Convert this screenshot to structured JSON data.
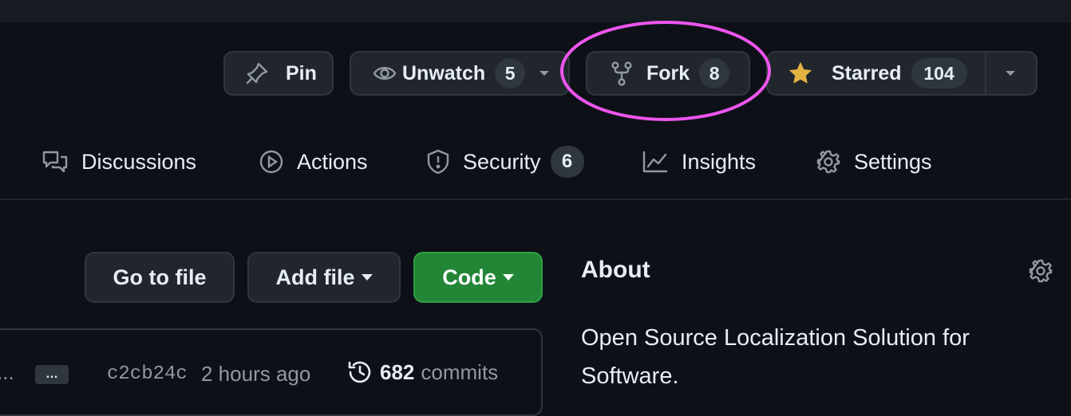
{
  "header": {
    "pin_label": "Pin",
    "unwatch_label": "Unwatch",
    "unwatch_count": "5",
    "fork_label": "Fork",
    "fork_count": "8",
    "starred_label": "Starred",
    "starred_count": "104"
  },
  "tabs": [
    {
      "label": "Discussions",
      "icon": "comment-discussion-icon"
    },
    {
      "label": "Actions",
      "icon": "play-icon"
    },
    {
      "label": "Security",
      "icon": "shield-icon",
      "counter": "6"
    },
    {
      "label": "Insights",
      "icon": "graph-icon"
    },
    {
      "label": "Settings",
      "icon": "gear-icon"
    }
  ],
  "toolbar": {
    "go_to_file": "Go to file",
    "add_file": "Add file",
    "code": "Code"
  },
  "commit": {
    "leading": "...",
    "ellipsis": "…",
    "sha": "c2cb24c",
    "time": "2 hours ago",
    "count": "682",
    "count_label": "commits"
  },
  "about": {
    "heading": "About",
    "description_line1": "Open Source Localization Solution for",
    "description_line2": "Software."
  },
  "colors": {
    "background": "#0d1117",
    "button": "#21262d",
    "border": "#30363d",
    "star": "#e3b341",
    "code_button": "#238636",
    "highlight_circle": "#ee55ee"
  }
}
